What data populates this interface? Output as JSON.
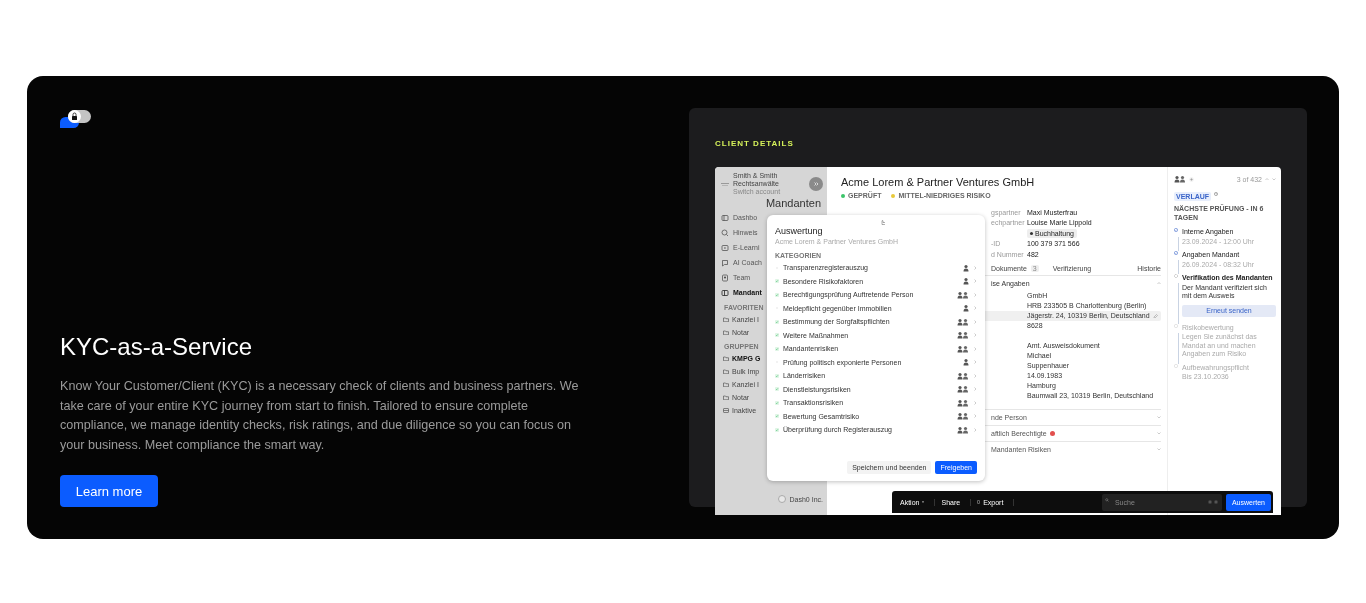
{
  "hero": {
    "title": "KYC-as-a-Service",
    "description": "Know Your Customer/Client (KYC) is a necessary check of clients and business partners. We take care of your entire KYC journey from start to finish. Tailored to ensure complete compliance, we manage identity checks, risk ratings, and due diligence so you can focus on your business. Meet compliance the smart way.",
    "button": "Learn more"
  },
  "mockup": {
    "label": "CLIENT DETAILS",
    "sidebar": {
      "account_name": "Smith & Smith",
      "account_sub": "Rechtsanwälte",
      "account_switch": "Switch account",
      "page_heading": "Mandanten",
      "nav": [
        {
          "label": "Dashbo",
          "selected": false
        },
        {
          "label": "Hinweis",
          "selected": false
        },
        {
          "label": "E-Learni",
          "selected": false
        },
        {
          "label": "AI Coach",
          "selected": false
        },
        {
          "label": "Team",
          "selected": false
        },
        {
          "label": "Mandant",
          "selected": true
        }
      ],
      "sections": [
        {
          "title": "FAVORITEN",
          "items": [
            {
              "label": "Kanzlei I",
              "kind": "folder",
              "selected": false
            },
            {
              "label": "Notar",
              "kind": "folder",
              "selected": false
            }
          ]
        },
        {
          "title": "GRUPPEN",
          "items": [
            {
              "label": "KMPG G",
              "kind": "folder",
              "selected": true
            },
            {
              "label": "Bulk Imp",
              "kind": "folder",
              "selected": false
            },
            {
              "label": "Kanzlei I",
              "kind": "folder",
              "selected": false
            },
            {
              "label": "Notar",
              "kind": "folder",
              "selected": false
            },
            {
              "label": "Inaktive",
              "kind": "archive",
              "selected": false
            }
          ]
        }
      ],
      "list_item": {
        "label": "Dash0 Inc.",
        "checked": false
      }
    },
    "client": {
      "title": "Acme Lorem & Partner Ventures GmbH",
      "badges": [
        {
          "label": "GEPRÜFT",
          "color": "#3cc46a"
        },
        {
          "label": "MITTEL-NIEDRIGES RISIKO",
          "color": "#e8c93a"
        }
      ],
      "fields": [
        {
          "kind": "text",
          "label": "gspartner",
          "value": "Maxi Musterfrau"
        },
        {
          "kind": "text",
          "label": "echpartner",
          "value": "Louise Marie Lippold"
        },
        {
          "kind": "tag",
          "value": "Buchhaltung"
        },
        {
          "kind": "text",
          "label": "-ID",
          "value": "100 379 371 566"
        },
        {
          "kind": "text",
          "label": "d Nummer",
          "value": "482"
        }
      ],
      "tabs": [
        {
          "label": "Dokumente",
          "count": "3"
        },
        {
          "label": "Verifizierung"
        },
        {
          "label": "Historie"
        }
      ],
      "section": {
        "title": "ise Angaben",
        "expanded": true,
        "groups": [
          [
            {
              "value": "GmbH",
              "highlighted": false
            },
            {
              "value": "HRB 233505 B Charlottenburg (Berlin)",
              "highlighted": false
            },
            {
              "value": "Jägerstr. 24, 10319 Berlin, Deutschland",
              "highlighted": true
            },
            {
              "value": "8628",
              "highlighted": false
            }
          ],
          [
            {
              "value": "Amt. Ausweisdokument",
              "highlighted": false
            },
            {
              "value": "Michael",
              "highlighted": false
            },
            {
              "value": "Suppenhauer",
              "highlighted": false
            },
            {
              "value": "14.09.1983",
              "highlighted": false
            },
            {
              "value": "Hamburg",
              "highlighted": false
            },
            {
              "value": "Baumwall 23, 10319 Berlin, Deutschland",
              "highlighted": false
            }
          ]
        ]
      },
      "accordions": [
        {
          "title": "nde Person",
          "alert": false,
          "expanded": false
        },
        {
          "title": "aftlich Berechtigte",
          "alert": true,
          "expanded": false
        },
        {
          "title": "Mandanten Risiken",
          "alert": false,
          "expanded": false
        }
      ]
    },
    "timeline": {
      "position": "3 of 432",
      "tag": "VERLAUF",
      "next_check": "NÄCHSTE PRÜFUNG - IN 6 TAGEN",
      "steps": [
        {
          "title": "Interne Angaben",
          "subtitle": "23.09.2024 - 12:00 Uhr",
          "completed": true,
          "active": false
        },
        {
          "title": "Angaben Mandant",
          "subtitle": "26.09.2024 - 08:32 Uhr",
          "completed": true,
          "active": false
        },
        {
          "title": "Verifikation des Mandanten",
          "subtitle": "Der Mandant verifiziert sich mit dem Ausweis",
          "completed": false,
          "active": true,
          "action": "Erneut senden"
        },
        {
          "title": "Risikobewertung",
          "subtitle": "Legen Sie zunächst das Mandat an und machen Angaben zum Risiko",
          "completed": false,
          "active": false
        },
        {
          "title": "Aufbewahrungspflicht",
          "subtitle": "Bis 23.10.2036",
          "completed": false,
          "active": false
        }
      ]
    },
    "modal": {
      "title": "Auswertung",
      "subtitle": "Acme Lorem & Partner Ventures GmbH",
      "heading": "KATEGORIEN",
      "rows": [
        {
          "label": "Transparenzregisterauszug",
          "done": false,
          "kind": "single"
        },
        {
          "label": "Besondere Risikofaktoren",
          "done": true,
          "kind": "single"
        },
        {
          "label": "Berechtigungsprüfung Auftretende Person",
          "done": true,
          "kind": "pair"
        },
        {
          "label": "Meldepflicht gegenüber Immobilien",
          "done": false,
          "kind": "single"
        },
        {
          "label": "Bestimmung der Sorgfaltspflichten",
          "done": true,
          "kind": "pair"
        },
        {
          "label": "Weitere Maßnahmen",
          "done": true,
          "kind": "pair"
        },
        {
          "label": "Mandantenrisiken",
          "done": true,
          "kind": "pair"
        },
        {
          "label": "Prüfung politisch exponierte Personen",
          "done": false,
          "kind": "single"
        },
        {
          "label": "Länderrisiken",
          "done": true,
          "kind": "pair"
        },
        {
          "label": "Dienstleistungsrisiken",
          "done": true,
          "kind": "pair"
        },
        {
          "label": "Transaktionsrisiken",
          "done": true,
          "kind": "pair"
        },
        {
          "label": "Bewertung Gesamtrisiko",
          "done": true,
          "kind": "pair"
        },
        {
          "label": "Überprüfung durch Registerauszug",
          "done": true,
          "kind": "pair"
        }
      ],
      "secondary_button": "Speichern und beenden",
      "primary_button": "Freigeben"
    },
    "toolbar": {
      "action": "Aktion",
      "share": "Share",
      "export": "Export",
      "search_placeholder": "Suche",
      "submit": "Auswerten"
    }
  }
}
